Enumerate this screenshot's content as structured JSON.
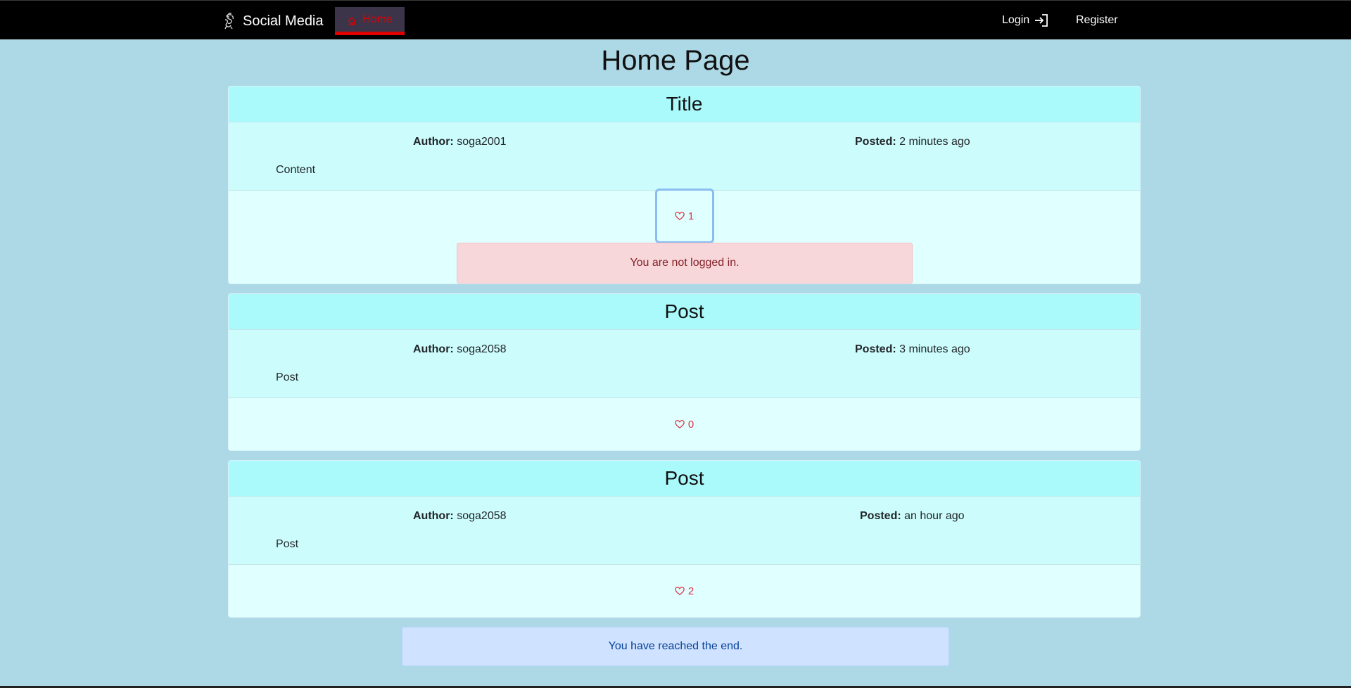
{
  "navbar": {
    "brand": "Social Media",
    "home_label": "Home",
    "login_label": "Login",
    "register_label": "Register"
  },
  "page_title": "Home Page",
  "posts": [
    {
      "title": "Title",
      "author_label": "Author:",
      "author": "soga2001",
      "posted_label": "Posted:",
      "posted": "2 minutes ago",
      "content": "Content",
      "likes": "1",
      "alert": "You are not logged in."
    },
    {
      "title": "Post",
      "author_label": "Author:",
      "author": "soga2058",
      "posted_label": "Posted:",
      "posted": "3 minutes ago",
      "content": "Post",
      "likes": "0"
    },
    {
      "title": "Post",
      "author_label": "Author:",
      "author": "soga2058",
      "posted_label": "Posted:",
      "posted": "an hour ago",
      "content": "Post",
      "likes": "2"
    }
  ],
  "end_message": "You have reached the end.",
  "colors": {
    "page_bg": "#add8e6",
    "navbar_bg": "#000000",
    "accent_red": "#e00000",
    "card_header": "#aafafc",
    "card_body": "#ccfcfc",
    "card_footer": "#e0ffff",
    "alert_danger_bg": "#f8d7da",
    "alert_info_bg": "#cfe2ff"
  },
  "icons": {
    "brand": "logo-icon",
    "home": "house-icon",
    "login": "box-arrow-in-right-icon",
    "like": "heart-icon"
  }
}
